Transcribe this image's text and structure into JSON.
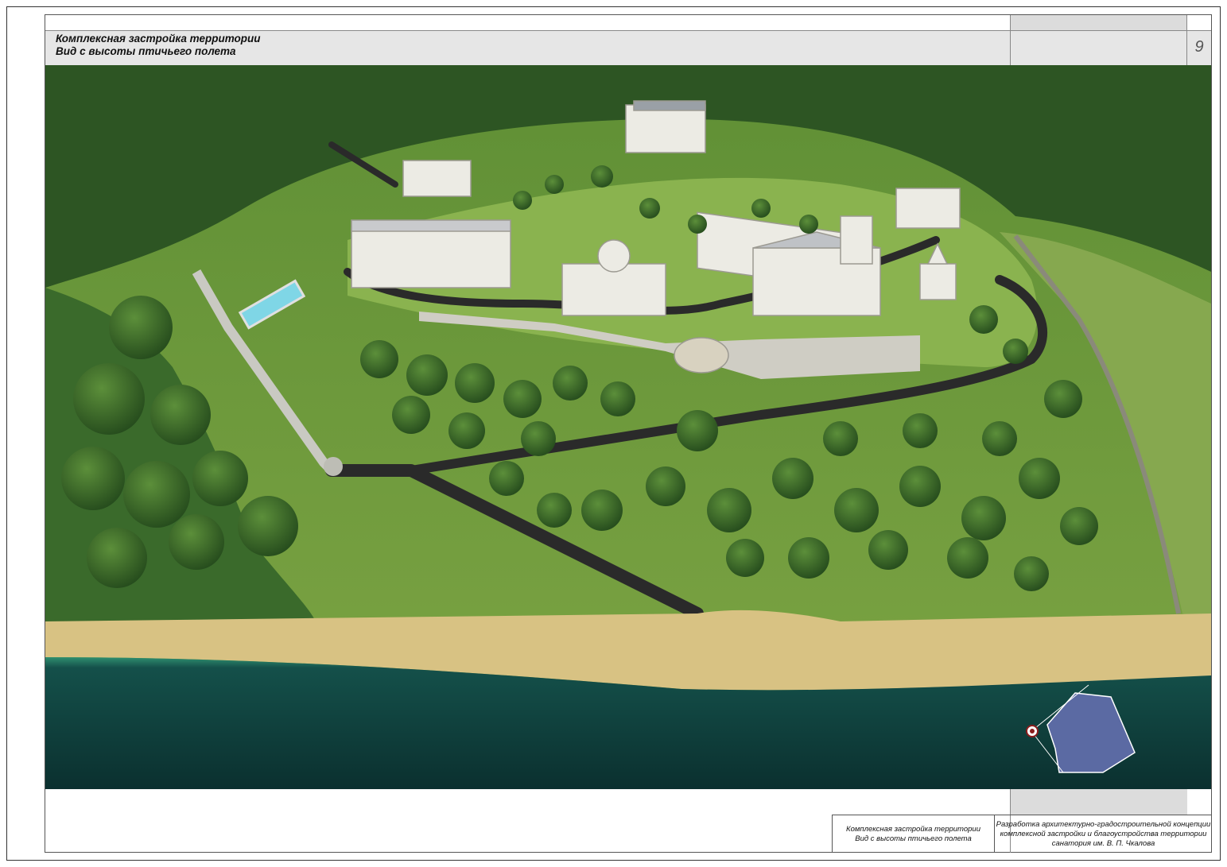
{
  "header": {
    "title_line1": "Комплексная застройка территории",
    "title_line2": "Вид с высоты птичьего полета",
    "page_number": "9"
  },
  "stamp": {
    "left_line1": "Комплексная застройка территории",
    "left_line2": "Вид с высоты птичьего полета",
    "right_line1": "Разработка архитектурно-градостроительной концепции",
    "right_line2": "комплексной застройки и благоустройства территории",
    "right_line3": "санатория им. В. П. Чкалова"
  },
  "colors": {
    "grass": "#6f9a3e",
    "forest": "#2f5a24",
    "sand": "#d8c283",
    "water": "#0f3d3a",
    "road": "#2a2a2a",
    "building": "#ecebe4",
    "site_plan": "#5b6aa3"
  }
}
